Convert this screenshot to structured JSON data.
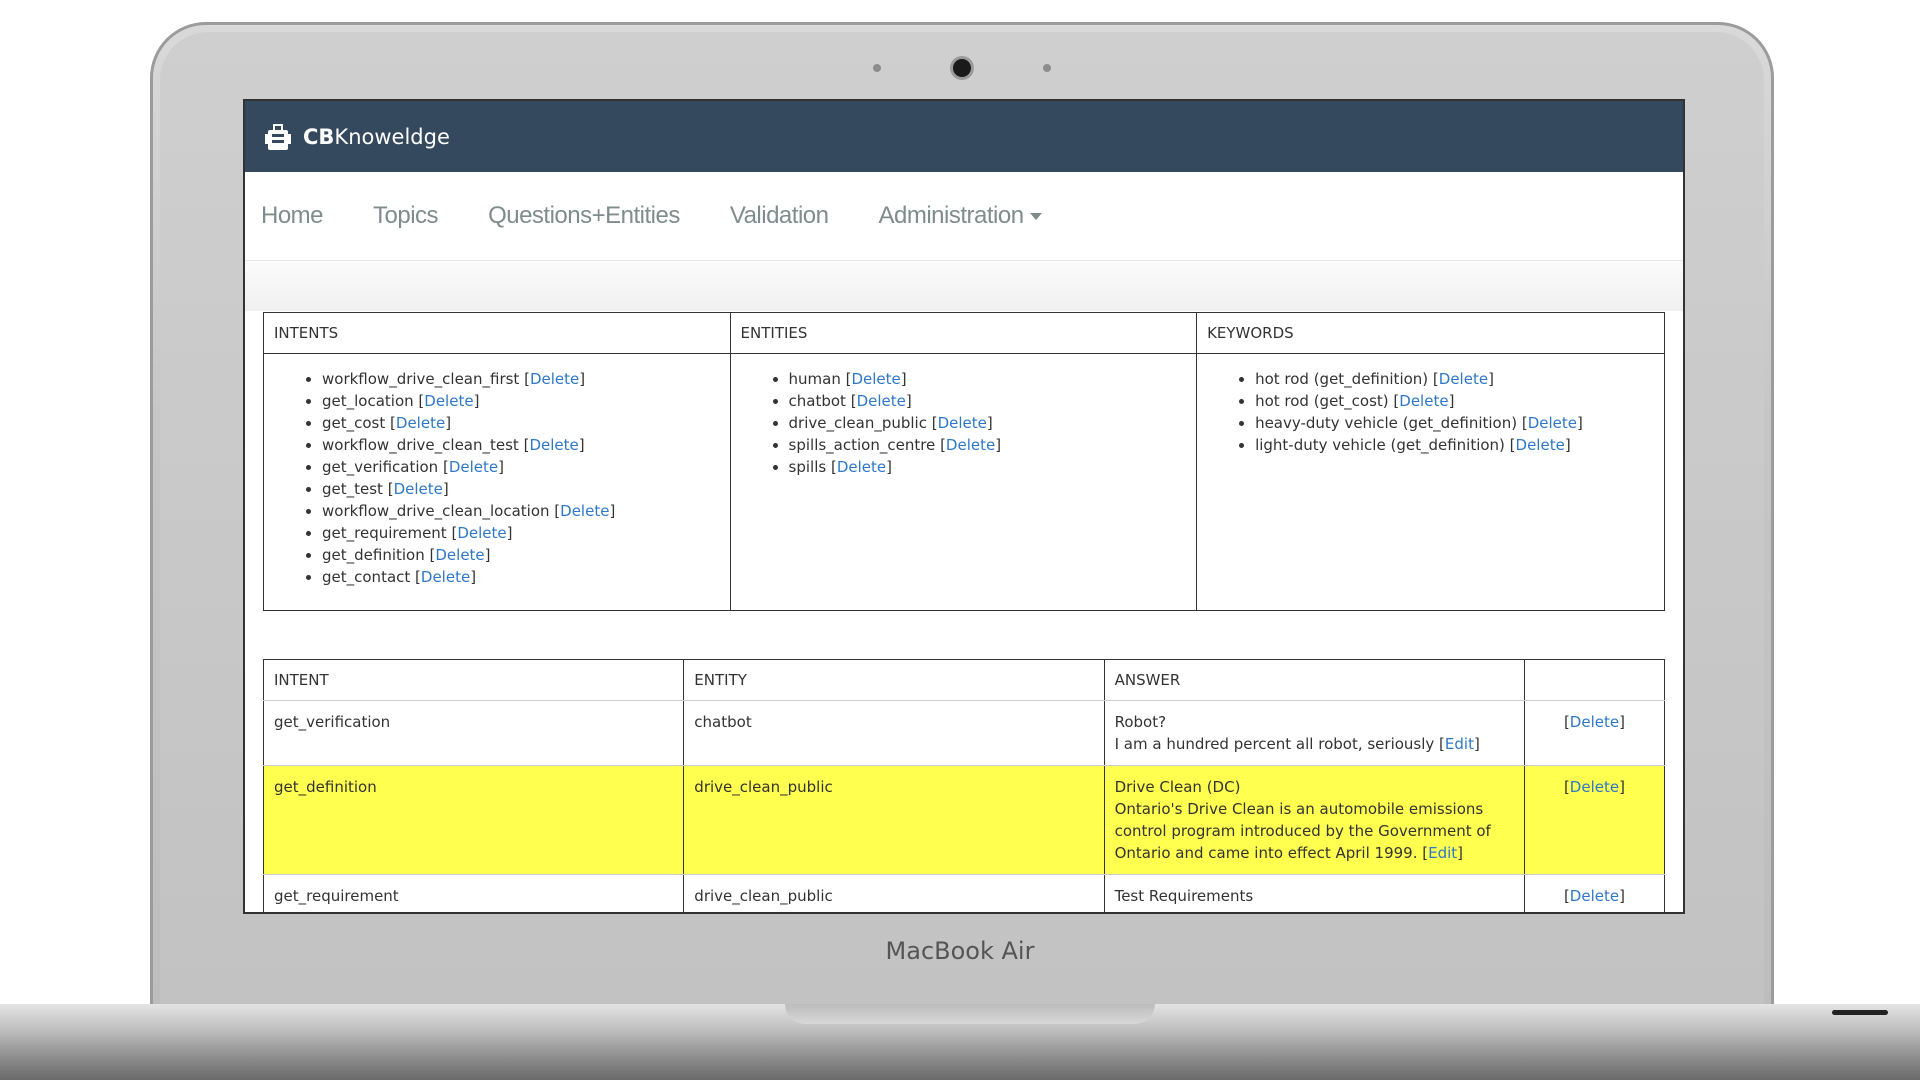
{
  "app": {
    "brand_bold": "CB",
    "brand_rest": "Knoweldge",
    "device_label": "MacBook Air"
  },
  "nav": [
    {
      "label": "Home"
    },
    {
      "label": "Topics"
    },
    {
      "label": "Questions+Entities"
    },
    {
      "label": "Validation"
    },
    {
      "label": "Administration"
    }
  ],
  "summary": {
    "headers": {
      "intents": "INTENTS",
      "entities": "ENTITIES",
      "keywords": "KEYWORDS"
    },
    "intents": [
      "workflow_drive_clean_first",
      "get_location",
      "get_cost",
      "workflow_drive_clean_test",
      "get_verification",
      "get_test",
      "workflow_drive_clean_location",
      "get_requirement",
      "get_definition",
      "get_contact"
    ],
    "entities": [
      "human",
      "chatbot",
      "drive_clean_public",
      "spills_action_centre",
      "spills"
    ],
    "keywords": [
      "hot rod (get_definition)",
      "hot rod (get_cost)",
      "heavy-duty vehicle (get_definition)",
      "light-duty vehicle (get_definition)"
    ],
    "delete_label": "Delete"
  },
  "answers": {
    "headers": {
      "intent": "INTENT",
      "entity": "ENTITY",
      "answer": "ANSWER",
      "actions": ""
    },
    "rows": [
      {
        "intent": "get_verification",
        "entity": "chatbot",
        "title": "Robot?",
        "text": "I am a hundred percent all robot, seriously",
        "highlight": false
      },
      {
        "intent": "get_definition",
        "entity": "drive_clean_public",
        "title": "Drive Clean (DC)",
        "text": "Ontario's Drive Clean is an automobile emissions control program introduced by the Government of Ontario and came into effect April 1999.",
        "highlight": true
      },
      {
        "intent": "get_requirement",
        "entity": "drive_clean_public",
        "title": "Test Requirements",
        "text": "",
        "highlight": false
      }
    ],
    "edit_label": "Edit",
    "delete_label": "Delete"
  }
}
